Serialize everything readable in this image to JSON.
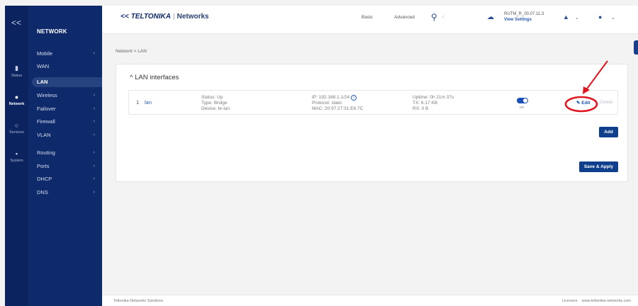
{
  "sidebar": {
    "collapse_label": "<<",
    "section_title": "NETWORK",
    "rail": [
      {
        "label": "Status",
        "icon": "status-icon"
      },
      {
        "label": "Network",
        "icon": "network-icon"
      },
      {
        "label": "Services",
        "icon": "services-icon"
      },
      {
        "label": "System",
        "icon": "system-icon"
      }
    ],
    "menu": [
      {
        "label": "Mobile",
        "has_submenu": true
      },
      {
        "label": "WAN",
        "has_submenu": false
      },
      {
        "label": "LAN",
        "has_submenu": false,
        "active": true
      },
      {
        "label": "Wireless",
        "has_submenu": true
      },
      {
        "label": "Failover",
        "has_submenu": true
      },
      {
        "label": "Firewall",
        "has_submenu": true
      },
      {
        "label": "VLAN",
        "has_submenu": true
      },
      {
        "label": "Routing",
        "has_submenu": true
      },
      {
        "label": "Ports",
        "has_submenu": true
      },
      {
        "label": "DHCP",
        "has_submenu": true
      },
      {
        "label": "DNS",
        "has_submenu": true
      }
    ]
  },
  "header": {
    "logo_mark": "<<",
    "logo_brand": "TELTONIKA",
    "logo_separator": "|",
    "logo_suffix": "Networks",
    "mode_basic": "Basic",
    "mode_advanced": "Advanced",
    "search_badge": "/",
    "device_name": "RUTM_R_00.07.11.3",
    "device_link": "View Settings"
  },
  "breadcrumb": "Network > LAN",
  "panel": {
    "title": "LAN interfaces",
    "rows": [
      {
        "number": "1",
        "name": "lan",
        "status": "Status: Up",
        "type": "Type: Bridge",
        "device": "Device: br-lan",
        "ip": "IP: 192.168.1.1/24",
        "protocol": "Protocol: static",
        "mac": "MAC: 20:97:27:31:E6:7C",
        "uptime": "Uptime: 0h 21m 37s",
        "tx": "TX: 6.17 KB",
        "rx": "RX: 0 B",
        "toggle_label": "on",
        "toggle_on": true,
        "edit_label": "Edit",
        "delete_label": "Delete"
      }
    ],
    "add_label": "Add",
    "save_label": "Save & Apply"
  },
  "footer": {
    "left": "Teltonika Networks Solutions",
    "licenses": "Licenses",
    "site": "www.teltonika-networks.com"
  },
  "colors": {
    "sidebar": "#0e2a6b",
    "accent": "#1a50b8",
    "annotation": "#e0141e"
  }
}
